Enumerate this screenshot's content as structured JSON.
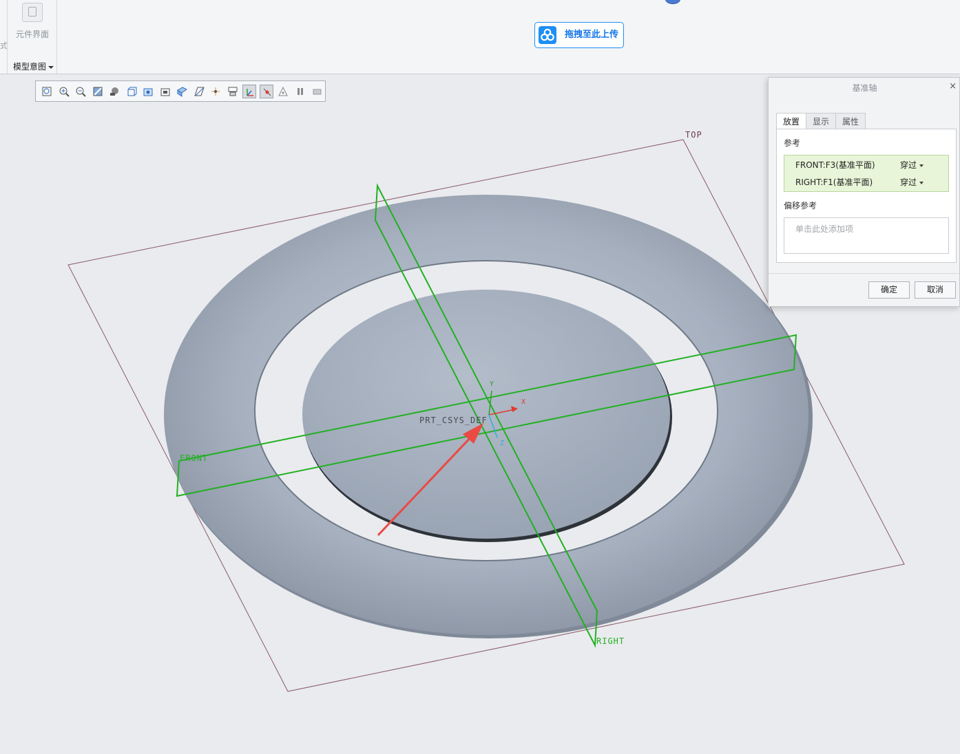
{
  "ribbon": {
    "edge_char": "式",
    "component_label": "元件界面",
    "model_intent_label": "模型意图",
    "upload_label": "拖拽至此上传"
  },
  "toolbar": {
    "buttons": [
      {
        "name": "refit-icon"
      },
      {
        "name": "zoom-in-icon"
      },
      {
        "name": "zoom-out-icon"
      },
      {
        "name": "repaint-icon"
      },
      {
        "name": "display-style-icon"
      },
      {
        "name": "saved-orientations-icon"
      },
      {
        "name": "view-manager-icon"
      },
      {
        "name": "perspective-icon"
      },
      {
        "name": "section-icon"
      },
      {
        "name": "datum-display-icon"
      },
      {
        "name": "spin-center-icon"
      },
      {
        "name": "annotation-display-icon"
      },
      {
        "name": "csys-display-icon",
        "active": true
      },
      {
        "name": "axis-display-icon",
        "active": true
      },
      {
        "name": "point-display-icon"
      },
      {
        "name": "pause-icon"
      },
      {
        "name": "regenerate-icon"
      }
    ]
  },
  "viewport": {
    "labels": {
      "top": "TOP",
      "front": "FRONT",
      "right": "RIGHT",
      "csys": "PRT_CSYS_DEF",
      "x_axis": "X",
      "y_axis": "Y",
      "z_axis": "Z"
    },
    "colors": {
      "datum_plane_green": "#22b022",
      "top_plane_outline": "#8a5866",
      "model_fill": "#a7b1bf",
      "arrow_red": "#ea4a44"
    }
  },
  "dialog": {
    "title": "基准轴",
    "close_icon": "×",
    "tabs": [
      "放置",
      "显示",
      "属性"
    ],
    "active_tab": "放置",
    "references_label": "参考",
    "references": [
      {
        "name": "FRONT:F3(基准平面)",
        "type": "穿过"
      },
      {
        "name": "RIGHT:F1(基准平面)",
        "type": "穿过"
      }
    ],
    "offset_label": "偏移参考",
    "offset_placeholder": "单击此处添加项",
    "ok_label": "确定",
    "cancel_label": "取消"
  }
}
